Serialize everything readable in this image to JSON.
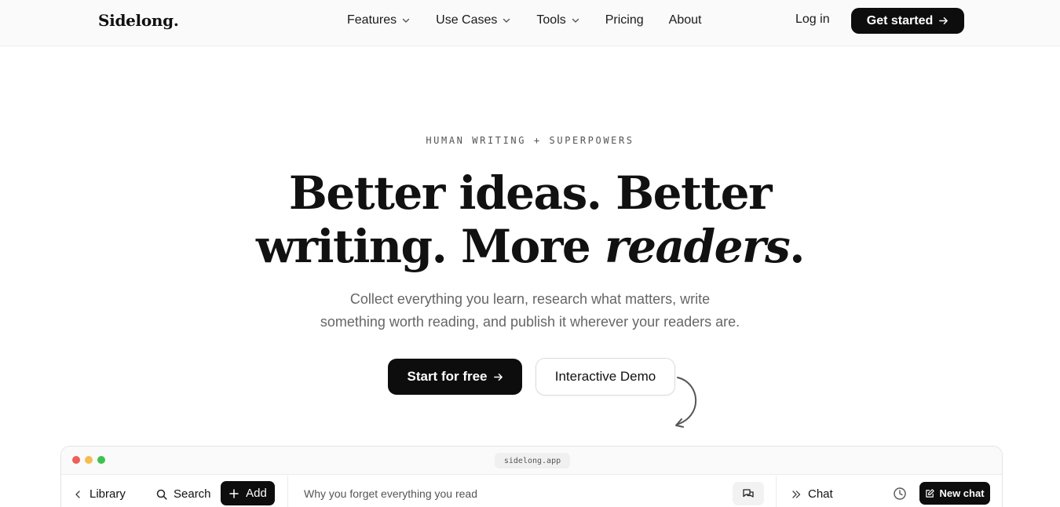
{
  "brand": {
    "logo": "Sidelong."
  },
  "nav": {
    "items": [
      {
        "label": "Features",
        "dropdown": true
      },
      {
        "label": "Use Cases",
        "dropdown": true
      },
      {
        "label": "Tools",
        "dropdown": true
      },
      {
        "label": "Pricing",
        "dropdown": false
      },
      {
        "label": "About",
        "dropdown": false
      }
    ],
    "login": "Log in",
    "cta": "Get started"
  },
  "hero": {
    "eyebrow": "HUMAN WRITING + SUPERPOWERS",
    "headline_line1": "Better ideas. Better",
    "headline_line2_a": "writing. More ",
    "headline_line2_em": "readers",
    "headline_line2_b": ".",
    "sub_line1": "Collect everything you learn, research what matters, write",
    "sub_line2": "something worth reading, and publish it wherever your readers are.",
    "primary_cta": "Start for free",
    "secondary_cta": "Interactive Demo"
  },
  "app_preview": {
    "url": "sidelong.app",
    "window_dots": [
      "#ed5f57",
      "#f5bd4f",
      "#3ec24f"
    ],
    "left": {
      "library": "Library",
      "search": "Search",
      "add": "Add"
    },
    "middle": {
      "doc_title": "Why you forget everything you read"
    },
    "right": {
      "chat": "Chat",
      "new_chat": "New chat"
    }
  },
  "colors": {
    "primary": "#0d0d0d",
    "muted_text": "#666666",
    "background": "#ffffff"
  },
  "icons": [
    "chevron-down-icon",
    "arrow-right-icon",
    "curved-arrow-icon",
    "chevron-left-icon",
    "search-icon",
    "plus-icon",
    "chat-bubbles-icon",
    "double-chevron-right-icon",
    "clock-icon",
    "edit-icon"
  ]
}
